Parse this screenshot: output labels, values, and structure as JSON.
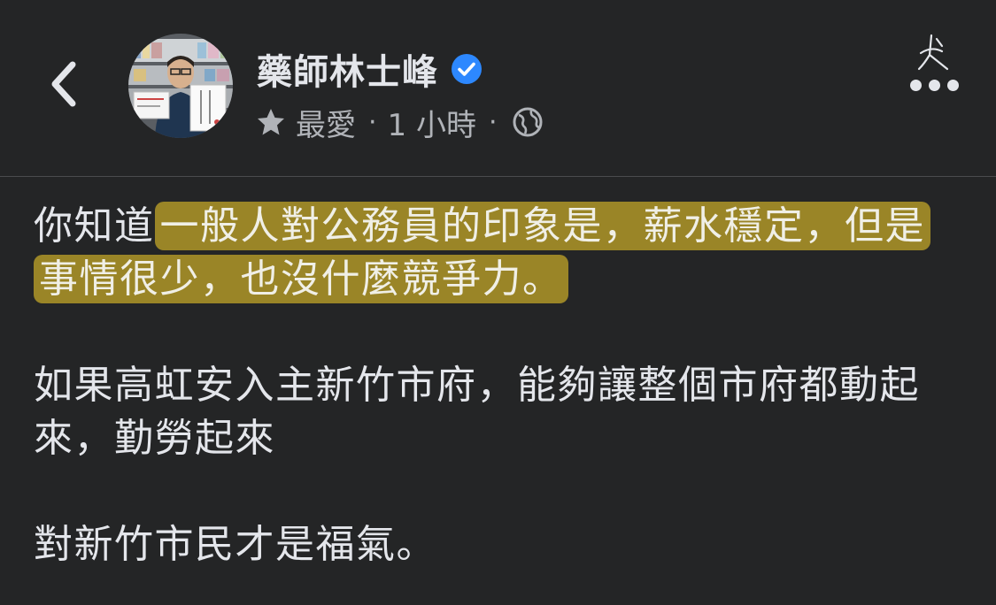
{
  "header": {
    "back_icon": "chevron-left-icon",
    "author_name": "藥師林士峰",
    "verified_icon": "verified-badge-icon",
    "meta": {
      "star_icon": "star-icon",
      "label": "最愛",
      "separator": "·",
      "time": "1 小時",
      "globe_icon": "globe-icon"
    },
    "more_icon": "more-dots-icon"
  },
  "post": {
    "p1_prefix": "你知道",
    "p1_highlight": "一般人對公務員的印象是，薪水穩定，但是事情很少，也沒什麼競爭力。",
    "p2": "如果高虹安入主新竹市府，能夠讓整個市府都動起來，勤勞起來",
    "p3": "對新竹市民才是福氣。"
  },
  "colors": {
    "background": "#242526",
    "text": "#e4e6eb",
    "secondary_text": "#b0b3b8",
    "verified_blue": "#2d88ff",
    "highlight": "#af9628"
  }
}
